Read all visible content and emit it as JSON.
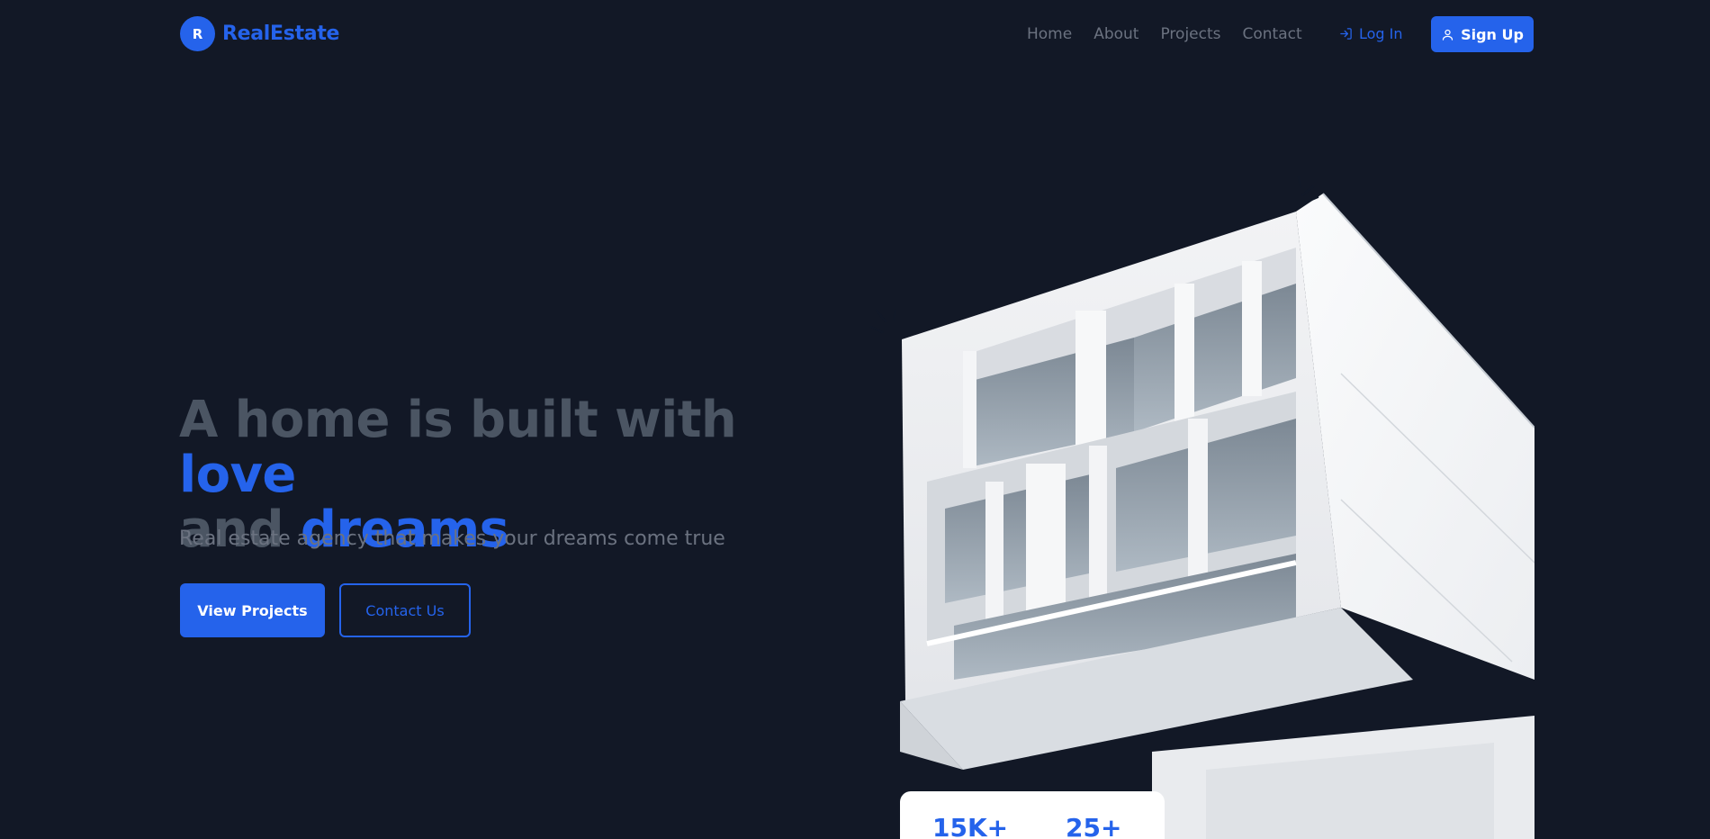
{
  "brand": {
    "initial": "R",
    "name": "RealEstate"
  },
  "nav": {
    "links": [
      "Home",
      "About",
      "Projects",
      "Contact"
    ],
    "login_label": "Log In",
    "signup_label": "Sign Up"
  },
  "hero": {
    "title_part1": "A home is built with ",
    "title_accent1": "love",
    "title_part2": "and ",
    "title_accent2": "dreams",
    "subtitle": "Real estate agency that makes your dreams come true",
    "primary_button": "View Projects",
    "secondary_button": "Contact Us"
  },
  "stats": [
    {
      "value": "15K+"
    },
    {
      "value": "25+"
    }
  ],
  "icons": {
    "login": "login-arrow-icon",
    "signup": "user-icon"
  },
  "colors": {
    "background": "#121826",
    "accent": "#2563eb",
    "title_muted": "#4b5563",
    "text_muted": "#6b7280"
  }
}
